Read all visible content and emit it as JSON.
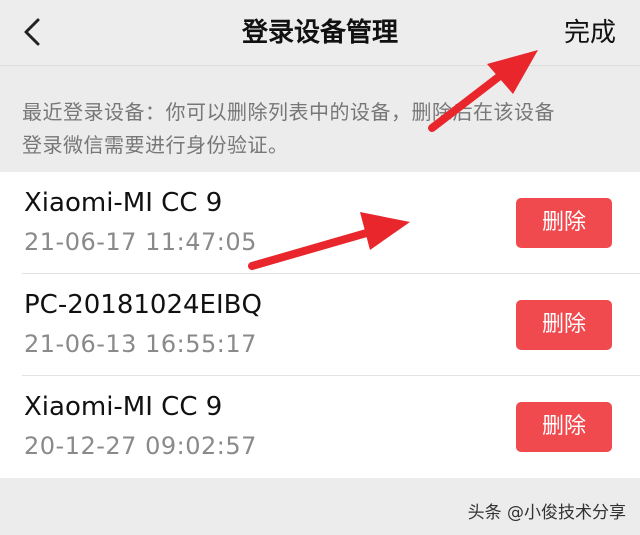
{
  "header": {
    "back_icon": "chevron-left-icon",
    "title": "登录设备管理",
    "done_label": "完成"
  },
  "description": {
    "line1": "最近登录设备：你可以删除列表中的设备，删除后在该设备",
    "line2": "登录微信需要进行身份验证。"
  },
  "devices": [
    {
      "name": "Xiaomi-MI CC 9",
      "time": "21-06-17 11:47:05",
      "delete_label": "删除"
    },
    {
      "name": "PC-20181024EIBQ",
      "time": "21-06-13 16:55:17",
      "delete_label": "删除"
    },
    {
      "name": "Xiaomi-MI CC 9",
      "time": "20-12-27 09:02:57",
      "delete_label": "删除"
    }
  ],
  "watermark": "头条 @小俊技术分享",
  "colors": {
    "delete_button": "#f04a4f",
    "arrow": "#e8262c",
    "background": "#ececec"
  }
}
